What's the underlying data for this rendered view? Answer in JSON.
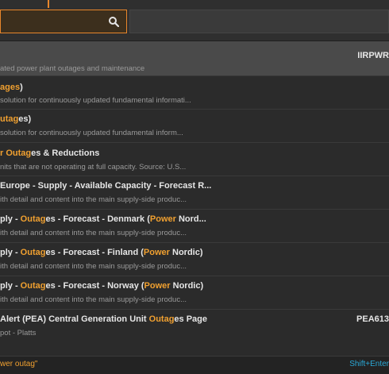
{
  "search": {
    "value": "",
    "placeholder": ""
  },
  "results": [
    {
      "title": "",
      "sub": "ated power plant outages and maintenance",
      "code": "IIRPWR"
    },
    {
      "title": "ages)",
      "sub": "solution for continuously updated fundamental informati...",
      "code": ""
    },
    {
      "title": "utages)",
      "sub": "solution for continuously updated fundamental inform...",
      "code": ""
    },
    {
      "title": "r Outages & Reductions",
      "sub": "nits that are not operating at full capacity. Source: U.S...",
      "code": ""
    },
    {
      "title": "Europe - Supply - Available Capacity - Forecast R...",
      "sub": "ith detail and content into the main supply-side produc...",
      "code": ""
    },
    {
      "title": "ply - Outages - Forecast - Denmark (Power Nord...",
      "sub": "ith detail and content into the main supply-side produc...",
      "code": ""
    },
    {
      "title": "ply - Outages - Forecast - Finland (Power Nordic)",
      "sub": "ith detail and content into the main supply-side produc...",
      "code": ""
    },
    {
      "title": "ply - Outages - Forecast - Norway (Power Nordic)",
      "sub": "ith detail and content into the main supply-side produc...",
      "code": ""
    },
    {
      "title": "Alert (PEA) Central Generation Unit Outages Page",
      "sub": "pot - Platts",
      "code": "PEA613"
    }
  ],
  "footer": {
    "hint": "wer outag\"",
    "shortcut": "Shift+Enter"
  },
  "colors": {
    "accent": "#f0a030",
    "link": "#2aa9d8"
  },
  "icons": {
    "search": "search-icon"
  }
}
